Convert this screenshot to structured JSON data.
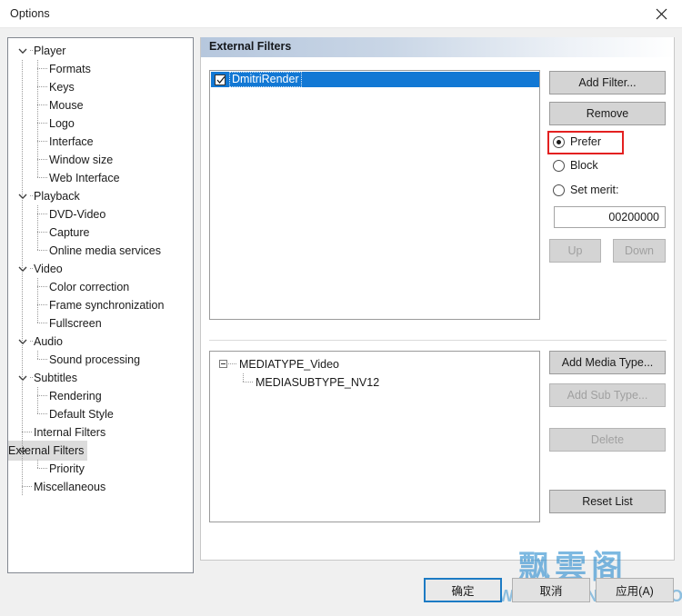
{
  "window": {
    "title": "Options",
    "close_icon": "close-icon"
  },
  "sidebar": {
    "items": [
      {
        "label": "Player",
        "level": 0,
        "expandable": true,
        "expanded": true,
        "selected": false
      },
      {
        "label": "Formats",
        "level": 1,
        "expandable": false,
        "expanded": false,
        "selected": false
      },
      {
        "label": "Keys",
        "level": 1,
        "expandable": false,
        "expanded": false,
        "selected": false
      },
      {
        "label": "Mouse",
        "level": 1,
        "expandable": false,
        "expanded": false,
        "selected": false
      },
      {
        "label": "Logo",
        "level": 1,
        "expandable": false,
        "expanded": false,
        "selected": false
      },
      {
        "label": "Interface",
        "level": 1,
        "expandable": false,
        "expanded": false,
        "selected": false
      },
      {
        "label": "Window size",
        "level": 1,
        "expandable": false,
        "expanded": false,
        "selected": false
      },
      {
        "label": "Web Interface",
        "level": 1,
        "expandable": false,
        "expanded": false,
        "selected": false
      },
      {
        "label": "Playback",
        "level": 0,
        "expandable": true,
        "expanded": true,
        "selected": false
      },
      {
        "label": "DVD-Video",
        "level": 1,
        "expandable": false,
        "expanded": false,
        "selected": false
      },
      {
        "label": "Capture",
        "level": 1,
        "expandable": false,
        "expanded": false,
        "selected": false
      },
      {
        "label": "Online media services",
        "level": 1,
        "expandable": false,
        "expanded": false,
        "selected": false
      },
      {
        "label": "Video",
        "level": 0,
        "expandable": true,
        "expanded": true,
        "selected": false
      },
      {
        "label": "Color correction",
        "level": 1,
        "expandable": false,
        "expanded": false,
        "selected": false
      },
      {
        "label": "Frame synchronization",
        "level": 1,
        "expandable": false,
        "expanded": false,
        "selected": false
      },
      {
        "label": "Fullscreen",
        "level": 1,
        "expandable": false,
        "expanded": false,
        "selected": false
      },
      {
        "label": "Audio",
        "level": 0,
        "expandable": true,
        "expanded": true,
        "selected": false
      },
      {
        "label": "Sound processing",
        "level": 1,
        "expandable": false,
        "expanded": false,
        "selected": false
      },
      {
        "label": "Subtitles",
        "level": 0,
        "expandable": true,
        "expanded": true,
        "selected": false
      },
      {
        "label": "Rendering",
        "level": 1,
        "expandable": false,
        "expanded": false,
        "selected": false
      },
      {
        "label": "Default Style",
        "level": 1,
        "expandable": false,
        "expanded": false,
        "selected": false
      },
      {
        "label": "Internal Filters",
        "level": 0,
        "expandable": false,
        "expanded": false,
        "selected": false
      },
      {
        "label": "External Filters",
        "level": 0,
        "expandable": true,
        "expanded": true,
        "selected": true
      },
      {
        "label": "Priority",
        "level": 1,
        "expandable": false,
        "expanded": false,
        "selected": false
      },
      {
        "label": "Miscellaneous",
        "level": 0,
        "expandable": false,
        "expanded": false,
        "selected": false
      }
    ]
  },
  "pane": {
    "header": "External Filters",
    "filter_list": [
      {
        "name": "DmitriRender",
        "checked": true,
        "selected": true
      }
    ],
    "buttons": {
      "add_filter": "Add Filter...",
      "remove": "Remove",
      "up": "Up",
      "down": "Down",
      "add_media_type": "Add Media Type...",
      "add_sub_type": "Add Sub Type...",
      "delete": "Delete",
      "reset_list": "Reset List"
    },
    "radios": {
      "prefer": "Prefer",
      "block": "Block",
      "set_merit": "Set merit:",
      "selected": "prefer"
    },
    "merit": {
      "value": "00200000",
      "placeholder": ""
    },
    "media_types": [
      {
        "label": "MEDIATYPE_Video",
        "level": 0,
        "expanded": true
      },
      {
        "label": "MEDIASUBTYPE_NV12",
        "level": 1,
        "expanded": false
      }
    ]
  },
  "footer": {
    "ok": "确定",
    "cancel": "取消",
    "apply": "应用(A)"
  },
  "watermark": {
    "text_cn": "飘雲阁",
    "url": "WWW.CHINAPYG.COM",
    "color": "#2f8fd0"
  },
  "colors": {
    "selection_blue": "#1278d4",
    "highlight_red": "#e32020",
    "focus_blue": "#1d7bc4",
    "header_gradient_start": "#b6c7dd"
  }
}
